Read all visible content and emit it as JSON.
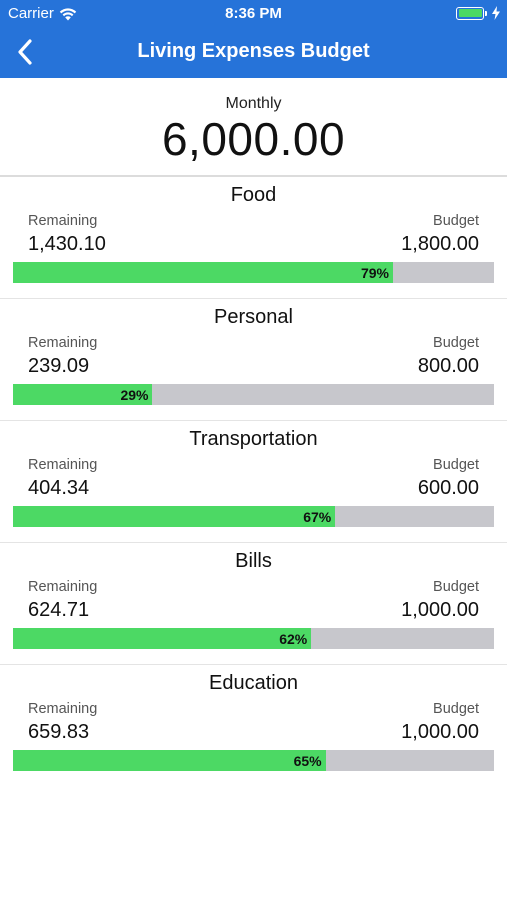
{
  "status_bar": {
    "carrier": "Carrier",
    "time": "8:36 PM",
    "battery_color": "#4cd964"
  },
  "nav": {
    "title": "Living Expenses Budget",
    "back_icon": "chevron-left-icon",
    "background_color": "#2673d9"
  },
  "summary": {
    "label": "Monthly",
    "amount": "6,000.00"
  },
  "labels": {
    "remaining": "Remaining",
    "budget": "Budget"
  },
  "colors": {
    "progress_fill": "#4cd964",
    "progress_track": "#c7c7cc"
  },
  "categories": [
    {
      "name": "Food",
      "remaining": "1,430.10",
      "budget": "1,800.00",
      "percent_label": "79%",
      "percent": 79
    },
    {
      "name": "Personal",
      "remaining": "239.09",
      "budget": "800.00",
      "percent_label": "29%",
      "percent": 29
    },
    {
      "name": "Transportation",
      "remaining": "404.34",
      "budget": "600.00",
      "percent_label": "67%",
      "percent": 67
    },
    {
      "name": "Bills",
      "remaining": "624.71",
      "budget": "1,000.00",
      "percent_label": "62%",
      "percent": 62
    },
    {
      "name": "Education",
      "remaining": "659.83",
      "budget": "1,000.00",
      "percent_label": "65%",
      "percent": 65
    }
  ]
}
